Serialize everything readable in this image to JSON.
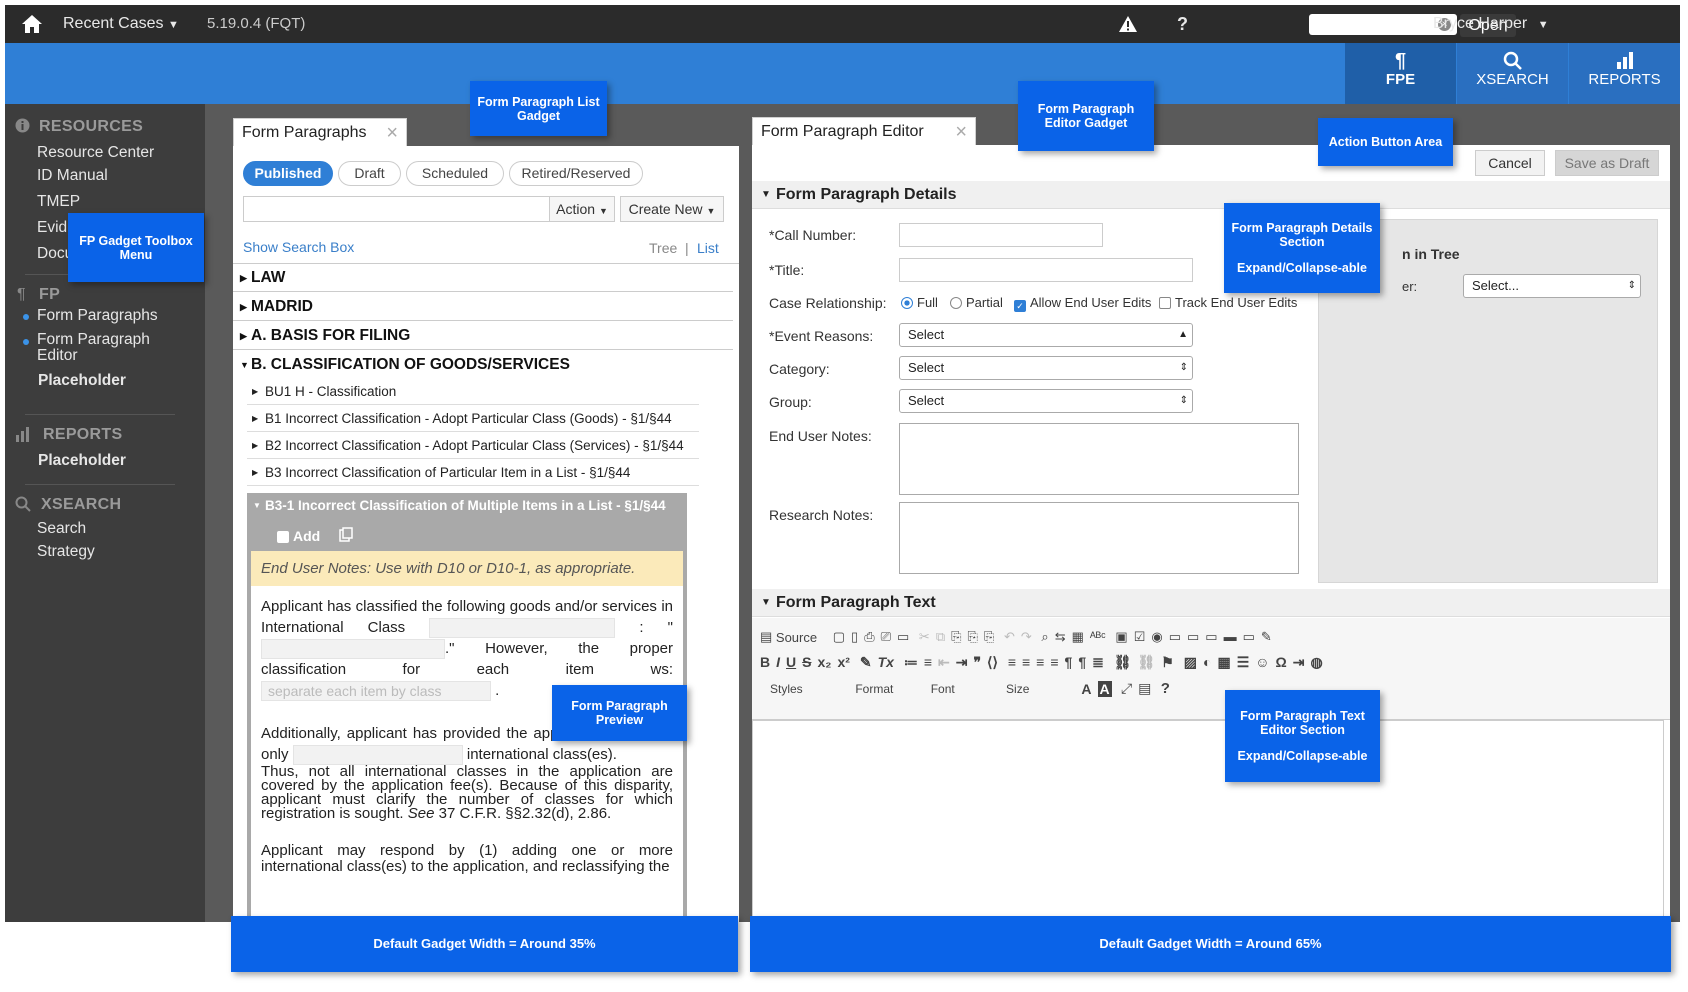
{
  "topbar": {
    "recent_cases": "Recent Cases",
    "version": "5.19.0.4 (FQT)",
    "warning_icon": "warning-icon",
    "help": "?",
    "open_button": "Open",
    "user": "Bryce Harper"
  },
  "nav": {
    "fpe": "FPE",
    "xsearch": "XSEARCH",
    "reports": "REPORTS"
  },
  "sidebar": {
    "resources": "RESOURCES",
    "resource_items": [
      "Resource Center",
      "ID Manual",
      "TMEP",
      "Evid",
      "Docu"
    ],
    "fp": "FP",
    "fp_items": [
      "Form Paragraphs",
      "Form Paragraph Editor",
      "Placeholder"
    ],
    "reports": "REPORTS",
    "reports_items": [
      "Placeholder"
    ],
    "xsearch": "XSEARCH",
    "xsearch_items": [
      "Search",
      "Strategy"
    ]
  },
  "list_gadget": {
    "tab": "Form Paragraphs",
    "pills": [
      "Published",
      "Draft",
      "Scheduled",
      "Retired/Reserved"
    ],
    "action": "Action",
    "create_new": "Create New",
    "show_search": "Show Search Box",
    "tree": "Tree",
    "sep": "|",
    "list": "List",
    "headers": [
      "LAW",
      "MADRID",
      "A. BASIS FOR FILING",
      "B. CLASSIFICATION OF GOODS/SERVICES"
    ],
    "subs": [
      "BU1 H - Classification",
      "B1 Incorrect Classification - Adopt Particular Class (Goods) - §1/§44",
      "B2 Incorrect Classification - Adopt Particular Class (Services) - §1/§44",
      "B3 Incorrect Classification of Particular Item in a List - §1/§44"
    ],
    "selected": "B3-1 Incorrect Classification of Multiple Items in a List - §1/§44",
    "add": "Add",
    "end_user_note": "End User Notes: Use with D10 or D10-1, as appropriate.",
    "p1a": "Applicant has classified the following goods and/or services in International Class",
    "p1b": ": \"",
    "p1c": ".\" However, the proper classification for each item",
    "p1d": "ws:",
    "placeholder": "separate each item by class",
    "period": ".",
    "p2a": "Additionally, applicant has provided the application fee(s) for only",
    "p2b": "international class(es).",
    "p2c": "Thus, not all international classes in the application are covered by the application fee(s). Because of this disparity, applicant must clarify the number of classes for which registration is sought.",
    "p2d": "See",
    "p2e": "37 C.F.R. §§2.32(d), 2.86.",
    "p3": "Applicant may respond by (1) adding one or more international class(es) to the application, and reclassifying the"
  },
  "editor_gadget": {
    "tab": "Form Paragraph Editor",
    "cancel": "Cancel",
    "save_draft": "Save as Draft",
    "details_header": "Form Paragraph Details",
    "call_number": "*Call Number:",
    "title": "*Title:",
    "case_relationship": "Case Relationship:",
    "full": "Full",
    "partial": "Partial",
    "allow_edits": "Allow End User Edits",
    "track_edits": "Track End User Edits",
    "event_reasons": "*Event Reasons:",
    "category": "Category:",
    "group": "Group:",
    "select": "Select",
    "end_user_notes": "End User Notes:",
    "research_notes": "Research Notes:",
    "in_tree": "n in Tree",
    "er_label": "er:",
    "select_dots": "Select...",
    "text_header": "Form Paragraph Text",
    "source": "Source",
    "styles": "Styles",
    "format": "Format",
    "font": "Font",
    "size": "Size",
    "help": "?"
  },
  "annotations": {
    "list_gadget": "Form Paragraph List Gadget",
    "editor_gadget": "Form Paragraph Editor Gadget",
    "action_area": "Action Button Area",
    "toolbox": "FP Gadget Toolbox Menu",
    "details": "Form Paragraph Details Section",
    "details_b": "Expand/Collapse-able",
    "preview": "Form Paragraph Preview",
    "text_editor": "Form Paragraph Text Editor Section",
    "text_editor_b": "Expand/Collapse-able",
    "width_35": "Default Gadget Width = Around 35%",
    "width_65": "Default Gadget Width = Around 65%"
  },
  "colors": {
    "accent": "#2f7fd6",
    "annotation": "#0a63e8",
    "topbar": "#2b2b2b",
    "note": "#fbeaba"
  }
}
